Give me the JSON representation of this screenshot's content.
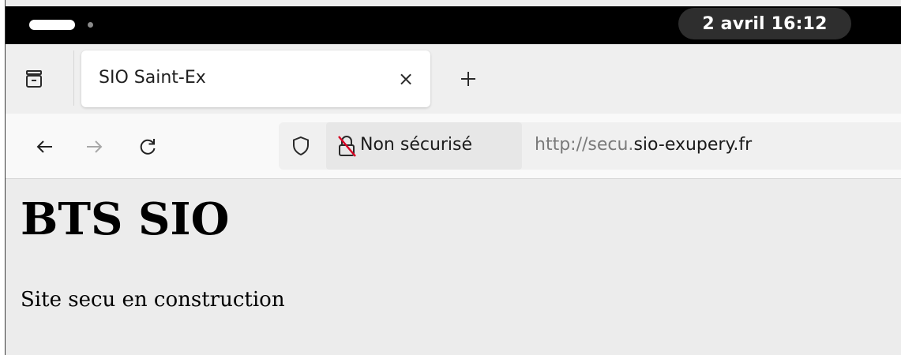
{
  "system_bar": {
    "clock": "2 avril  16:12"
  },
  "tabs": [
    {
      "title": "SIO Saint-Ex",
      "close_label": "×",
      "active": true
    }
  ],
  "new_tab_label": "+",
  "url_bar": {
    "identity_label": "Non sécurisé",
    "url_prefix": "http://secu.",
    "url_domain": "sio-exupery.fr"
  },
  "page": {
    "heading": "BTS SIO",
    "text": "Site secu en construction"
  },
  "icons": {
    "overview": "tab-overview-icon",
    "back": "back-arrow-icon",
    "forward": "forward-arrow-icon",
    "reload": "reload-icon",
    "tracking": "shield-icon",
    "insecure": "insecure-lock-icon",
    "new_tab": "plus-icon"
  },
  "colors": {
    "system_bar": "#000000",
    "insecure_slash": "#d70022",
    "page_background": "#ececec"
  }
}
